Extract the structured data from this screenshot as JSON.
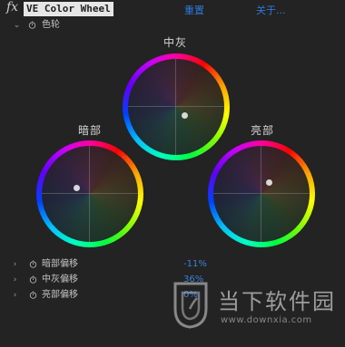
{
  "header": {
    "fx_label": "fx",
    "title": "VE Color Wheel",
    "reset_label": "重置",
    "about_label": "关于..."
  },
  "group": {
    "label": "色轮"
  },
  "wheels": {
    "midtones": {
      "label": "中灰"
    },
    "shadows": {
      "label": "暗部"
    },
    "highlights": {
      "label": "亮部"
    }
  },
  "properties": [
    {
      "label": "暗部偏移",
      "value": "-11%"
    },
    {
      "label": "中灰偏移",
      "value": "36%"
    },
    {
      "label": "亮部偏移",
      "value": "0%"
    }
  ],
  "watermark": {
    "name": "当下软件园",
    "url": "www.downxia.com"
  },
  "colors": {
    "link": "#2f78d9",
    "value": "#3a80d8",
    "background": "#232323"
  }
}
